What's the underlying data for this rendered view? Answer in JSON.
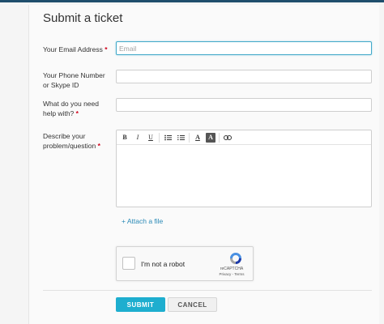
{
  "form": {
    "title": "Submit a ticket",
    "email": {
      "label": "Your Email Address",
      "required_mark": "*",
      "placeholder": "Email",
      "value": ""
    },
    "phone": {
      "label_line1": "Your Phone Number",
      "label_line2": "or Skype ID",
      "value": ""
    },
    "need": {
      "label_line1": "What do you need",
      "label_line2": "help with?",
      "required_mark": "*",
      "value": ""
    },
    "describe": {
      "label_line1": "Describe your",
      "label_line2": "problem/question",
      "required_mark": "*"
    },
    "toolbar": {
      "bold": "B",
      "italic": "I",
      "underline": "U",
      "bullet_list": "•≡",
      "numbered_list": "≡",
      "text_color": "A",
      "bg_color": "A",
      "link": "∞"
    },
    "attach_label": "+ Attach a file",
    "captcha": {
      "label": "I'm not a robot",
      "brand": "reCAPTCHA",
      "links": "Privacy - Terms",
      "checked": false
    },
    "submit_label": "SUBMIT",
    "cancel_label": "CANCEL"
  },
  "colors": {
    "accent": "#1eaecf",
    "link": "#2a8ab7",
    "required": "#d0021b",
    "topbar": "#1f4e6c",
    "focus_border": "#43a9c9"
  }
}
